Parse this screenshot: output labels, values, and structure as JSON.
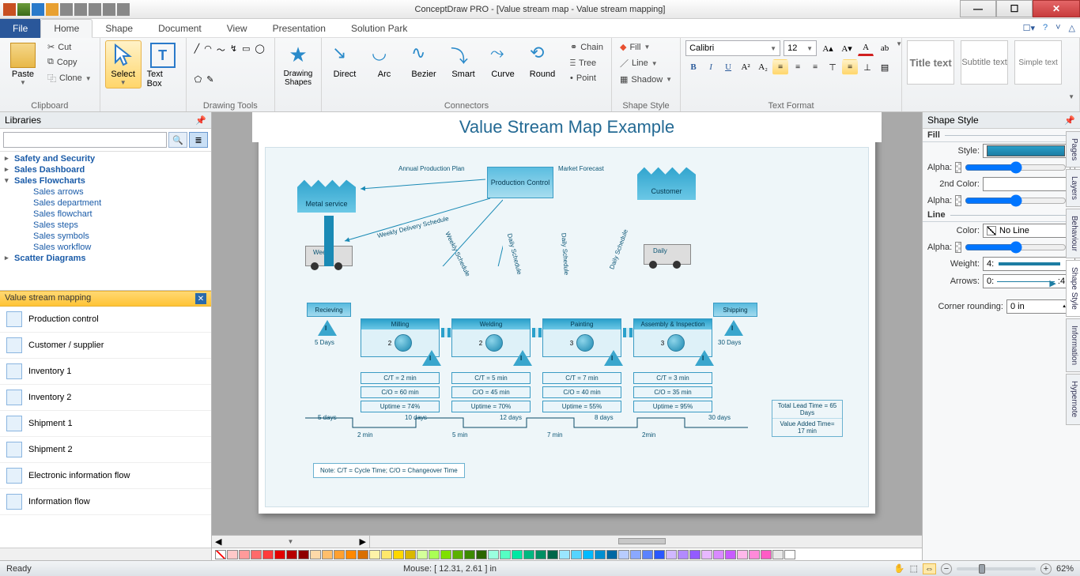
{
  "app_title": "ConceptDraw PRO - [Value stream map - Value stream mapping]",
  "ribbon": {
    "file": "File",
    "tabs": [
      "Home",
      "Shape",
      "Document",
      "View",
      "Presentation",
      "Solution Park"
    ],
    "active_tab": "Home",
    "clipboard": {
      "paste": "Paste",
      "cut": "Cut",
      "copy": "Copy",
      "clone": "Clone",
      "label": "Clipboard"
    },
    "select": "Select",
    "textbox": "Text Box",
    "drawing_tools_label": "Drawing Tools",
    "drawing_shapes": "Drawing Shapes",
    "connectors": {
      "direct": "Direct",
      "arc": "Arc",
      "bezier": "Bezier",
      "smart": "Smart",
      "curve": "Curve",
      "round": "Round",
      "chain": "Chain",
      "tree": "Tree",
      "point": "Point",
      "label": "Connectors"
    },
    "shape_style": {
      "fill": "Fill",
      "line": "Line",
      "shadow": "Shadow",
      "label": "Shape Style"
    },
    "font": "Calibri",
    "font_size": "12",
    "text_format_label": "Text Format",
    "previews": {
      "title": "Title text",
      "subtitle": "Subtitle text",
      "simple": "Simple text"
    }
  },
  "libraries": {
    "header": "Libraries",
    "tree": [
      {
        "t": "Safety and Security",
        "cat": true
      },
      {
        "t": "Sales Dashboard",
        "cat": true
      },
      {
        "t": "Sales Flowcharts",
        "cat": true,
        "open": true
      },
      {
        "t": "Sales arrows",
        "sub": true
      },
      {
        "t": "Sales department",
        "sub": true
      },
      {
        "t": "Sales flowchart",
        "sub": true
      },
      {
        "t": "Sales steps",
        "sub": true
      },
      {
        "t": "Sales symbols",
        "sub": true
      },
      {
        "t": "Sales workflow",
        "sub": true
      },
      {
        "t": "Scatter Diagrams",
        "cat": true
      }
    ],
    "stencil_header": "Value stream mapping",
    "stencils": [
      "Production control",
      "Customer / supplier",
      "Inventory 1",
      "Inventory 2",
      "Shipment 1",
      "Shipment 2",
      "Electronic information flow",
      "Information flow"
    ]
  },
  "diagram": {
    "title": "Value Stream Map Example",
    "supplier": "Metal service",
    "customer": "Customer",
    "control": "Production Control",
    "annual": "Annual Production Plan",
    "forecast": "Market Forecast",
    "weekly_delivery": "Weekly Delivery Schedule",
    "sched": [
      "Weekly Schedule",
      "Daily Schedule",
      "Daily Schedule",
      "Daily Schedule"
    ],
    "truck1": "Weekly",
    "truck2": "Daily",
    "recv": "Recieving",
    "ship": "Shipping",
    "recv_days": "5 Days",
    "ship_days": "30 Days",
    "processes": [
      {
        "name": "Milling",
        "c": "2",
        "ct": "C/T = 2 min",
        "co": "C/O = 60 min",
        "up": "Uptime = 74%"
      },
      {
        "name": "Welding",
        "c": "2",
        "ct": "C/T = 5 min",
        "co": "C/O = 45 min",
        "up": "Uptime = 70%"
      },
      {
        "name": "Painting",
        "c": "3",
        "ct": "C/T = 7 min",
        "co": "C/O = 40 min",
        "up": "Uptime = 55%"
      },
      {
        "name": "Assembly & Inspection",
        "c": "3",
        "ct": "C/T = 3 min",
        "co": "C/O = 35 min",
        "up": "Uptime = 95%"
      }
    ],
    "timeline_top": [
      "5 days",
      "10 days",
      "12 days",
      "8 days",
      "30 days"
    ],
    "timeline_bot": [
      "2 min",
      "5 min",
      "7 min",
      "2min"
    ],
    "totals": [
      "Total Lead Time = 65 Days",
      "Value Added Time= 17 min"
    ],
    "note": "Note: C/T = Cycle Time; C/O = Changeover Time"
  },
  "shape_style_panel": {
    "header": "Shape Style",
    "fill": "Fill",
    "style": "Style:",
    "alpha": "Alpha:",
    "second": "2nd Color:",
    "line": "Line",
    "color": "Color:",
    "noline": "No Line",
    "weight": "Weight:",
    "weight_val": "4:",
    "arrows": "Arrows:",
    "arrows_val": "0:",
    "arrows_end": ":4",
    "corner": "Corner rounding:",
    "corner_val": "0 in"
  },
  "side_tabs": [
    "Pages",
    "Layers",
    "Behaviour",
    "Shape Style",
    "Information",
    "Hypernote"
  ],
  "status": {
    "ready": "Ready",
    "mouse": "Mouse: [ 12.31, 2.61 ] in",
    "zoom": "62%"
  },
  "color_palette": [
    "#ffc8c8",
    "#ff9a9a",
    "#ff6b6b",
    "#ff3b3b",
    "#e30000",
    "#b70000",
    "#8f0000",
    "#ffd9a8",
    "#ffbe6b",
    "#ffa030",
    "#ff8800",
    "#d96f00",
    "#fff3a8",
    "#ffe86b",
    "#ffd700",
    "#d9b800",
    "#d4ff9a",
    "#aaff55",
    "#7fe000",
    "#5bb000",
    "#3c8a00",
    "#2a6600",
    "#9affdf",
    "#55ffc3",
    "#00e8a3",
    "#00b880",
    "#008f63",
    "#00664a",
    "#9ae6ff",
    "#55d4ff",
    "#00baff",
    "#008fd1",
    "#0068a3",
    "#b8ccff",
    "#8aa8ff",
    "#5b82ff",
    "#2a58ff",
    "#d0b8ff",
    "#b28aff",
    "#935bff",
    "#e8b8ff",
    "#da8aff",
    "#c85bff",
    "#ffb8ea",
    "#ff8ad9",
    "#ff5bc5",
    "#e8e8e8",
    "#ffffff"
  ]
}
